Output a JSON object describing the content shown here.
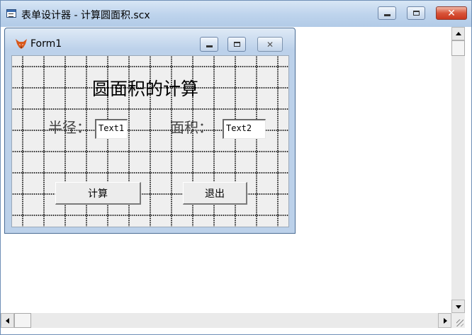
{
  "window": {
    "title": "表单设计器 - 计算圆面积.scx",
    "icon": "form-designer-icon"
  },
  "form": {
    "title": "Form1",
    "icon": "fox-icon",
    "heading": "圆面积的计算",
    "radius_label": "半径：",
    "radius_textbox": "Text1",
    "area_label": "面积：",
    "area_textbox": "Text2",
    "calc_button": "计算",
    "exit_button": "退出"
  },
  "colors": {
    "titlebar": "#bdd3ec",
    "close_button": "#d9553a",
    "canvas": "#efefef"
  }
}
